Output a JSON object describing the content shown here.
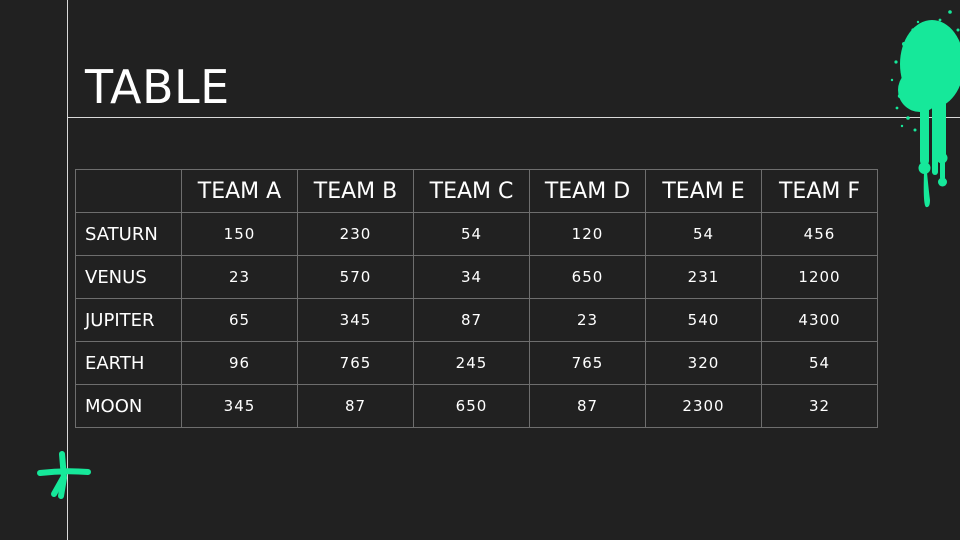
{
  "slide": {
    "title": "TABLE"
  },
  "table": {
    "header_blank": "",
    "columns": [
      "TEAM A",
      "TEAM B",
      "TEAM C",
      "TEAM D",
      "TEAM E",
      "TEAM F"
    ],
    "rows": [
      {
        "label": "SATURN",
        "values": [
          "150",
          "230",
          "54",
          "120",
          "54",
          "456"
        ]
      },
      {
        "label": "VENUS",
        "values": [
          "23",
          "570",
          "34",
          "650",
          "231",
          "1200"
        ]
      },
      {
        "label": "JUPITER",
        "values": [
          "65",
          "345",
          "87",
          "23",
          "540",
          "4300"
        ]
      },
      {
        "label": "EARTH",
        "values": [
          "96",
          "765",
          "245",
          "765",
          "320",
          "54"
        ]
      },
      {
        "label": "MOON",
        "values": [
          "345",
          "87",
          "650",
          "87",
          "2300",
          "32"
        ]
      }
    ]
  },
  "colors": {
    "background": "#212121",
    "accent": "#16e89a",
    "rule": "#d9d9d9"
  },
  "decorations": {
    "top_right": "paint-splash-icon",
    "bottom_left": "star-doodle-icon"
  }
}
